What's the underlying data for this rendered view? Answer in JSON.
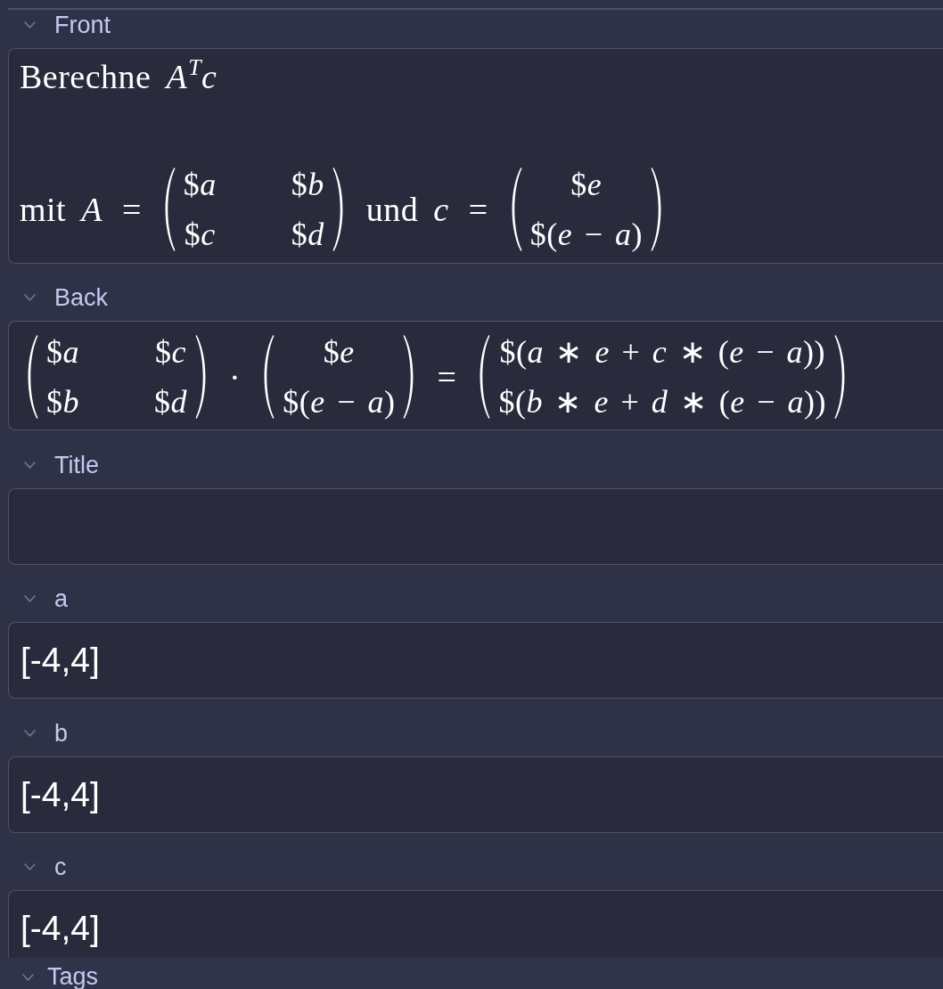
{
  "fields": [
    {
      "name": "Front",
      "expanded": true,
      "kind": "formula",
      "lines": [
        [
          {
            "kind": "text",
            "text": "Berechne"
          },
          {
            "kind": "math",
            "text": "*A*$^{T}$*c*"
          }
        ],
        [
          {
            "kind": "text",
            "text": "mit"
          },
          {
            "kind": "math",
            "text": "*A* ="
          },
          {
            "kind": "matrix",
            "rows": [
              [
                "$*a*",
                "$*b*"
              ],
              [
                "$*c*",
                "$*d*"
              ]
            ]
          },
          {
            "kind": "text",
            "text": "und"
          },
          {
            "kind": "math",
            "text": "*c* ="
          },
          {
            "kind": "matrix",
            "rows": [
              [
                "$*e*"
              ],
              [
                "$(*e* − *a*)"
              ]
            ]
          }
        ]
      ]
    },
    {
      "name": "Back",
      "expanded": true,
      "kind": "formula",
      "lines": [
        [
          {
            "kind": "matrix",
            "rows": [
              [
                "$*a*",
                "$*c*"
              ],
              [
                "$*b*",
                "$*d*"
              ]
            ]
          },
          {
            "kind": "math",
            "text": "·"
          },
          {
            "kind": "matrix",
            "rows": [
              [
                "$*e*"
              ],
              [
                "$(*e* − *a*)"
              ]
            ]
          },
          {
            "kind": "math",
            "text": "="
          },
          {
            "kind": "matrix",
            "rows": [
              [
                "$(*a* ∗ *e* + *c* ∗ (*e* − *a*))"
              ],
              [
                "$(*b* ∗ *e* + *d* ∗ (*e* − *a*))"
              ]
            ]
          }
        ]
      ]
    },
    {
      "name": "Title",
      "expanded": true,
      "kind": "text"
    },
    {
      "name": "a",
      "expanded": true,
      "kind": "text",
      "value": "[-4,4]"
    },
    {
      "name": "b",
      "expanded": true,
      "kind": "text",
      "value": "[-4,4]"
    },
    {
      "name": "c",
      "expanded": true,
      "kind": "text",
      "value": "[-4,4]"
    }
  ],
  "tags": {
    "label": "Tags",
    "expanded": true
  }
}
